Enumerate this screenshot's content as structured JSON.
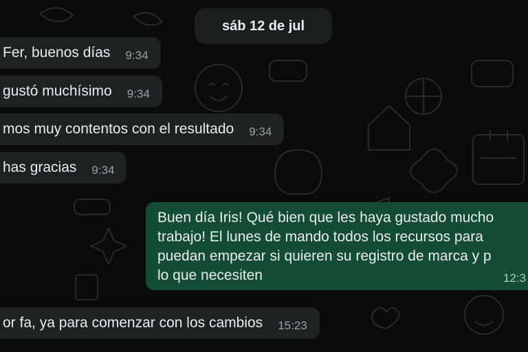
{
  "date_separator": "sáb 12 de jul",
  "incoming_messages": [
    {
      "text": "Fer, buenos días",
      "time": "9:34"
    },
    {
      "text": "gustó muchísimo",
      "time": "9:34"
    },
    {
      "text": "mos muy contentos con el resultado",
      "time": "9:34"
    },
    {
      "text": "has gracias",
      "time": "9:34"
    },
    {
      "text": "or fa, ya para comenzar con los cambios",
      "time": "15:23"
    }
  ],
  "outgoing_message": {
    "lines": [
      "Buen día Iris! Qué bien que les haya gustado mucho",
      "trabajo! El lunes de mando todos los recursos para",
      "puedan empezar si quieren su registro de marca y p",
      "lo que necesiten"
    ],
    "time": "12:3"
  },
  "colors": {
    "background": "#0b0b0b",
    "incoming_bubble": "#202121",
    "outgoing_bubble": "#144d37",
    "timestamp": "#9aa3a8"
  }
}
